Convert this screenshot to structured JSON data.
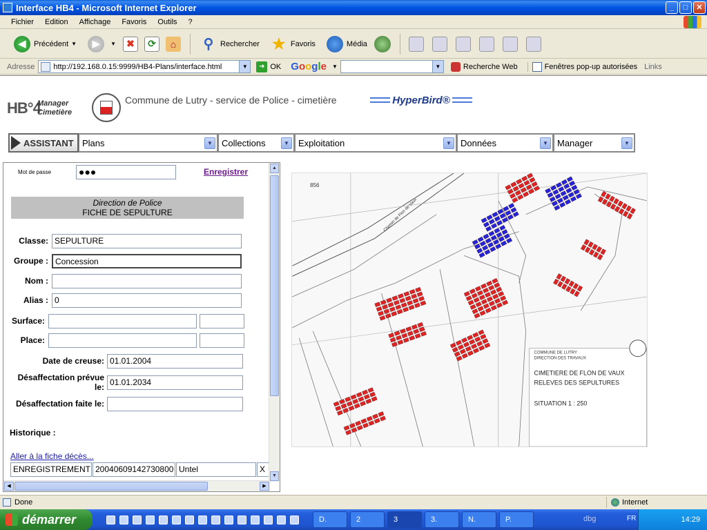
{
  "window": {
    "title": "Interface HB4 - Microsoft Internet Explorer",
    "buttons": [
      "_",
      "□",
      "✕"
    ]
  },
  "menubar": [
    "Fichier",
    "Edition",
    "Affichage",
    "Favoris",
    "Outils",
    "?"
  ],
  "toolbar": {
    "back_label": "Précédent",
    "search_label": "Rechercher",
    "favorites_label": "Favoris",
    "media_label": "Média"
  },
  "addressbar": {
    "label": "Adresse",
    "url": "http://192.168.0.15:9999/HB4-Plans/interface.html",
    "go_label": "OK",
    "google_search_value": "",
    "web_search_label": "Recherche Web",
    "popup_label": "Fenêtres pop-up autorisées",
    "links_label": "Links"
  },
  "app_header": {
    "logo_main": "HB°4",
    "logo_sub_line1": "Manager",
    "logo_sub_line2": "Cimetière",
    "commune_title": "Commune de Lutry - service de Police - cimetière",
    "brand": "HyperBird®"
  },
  "nav": {
    "assistant_label": "ASSISTANT",
    "menus": [
      {
        "label": "Plans"
      },
      {
        "label": "Collections"
      },
      {
        "label": "Exploitation"
      },
      {
        "label": "Données"
      },
      {
        "label": "Manager"
      }
    ]
  },
  "form": {
    "password_label": "Mot de passe",
    "password_value": "●●●",
    "save_link": "Enregistrer",
    "section_line1": "Direction de Police",
    "section_line2": "FICHE DE SEPULTURE",
    "classe_label": "Classe:",
    "classe_value": "SEPULTURE",
    "groupe_label": "Groupe :",
    "groupe_value": "Concession",
    "nom_label": "Nom :",
    "nom_value": "",
    "alias_label": "Alias :",
    "alias_value": "0",
    "surface_label": "Surface:",
    "place_label": "Place:",
    "date_creuse_label": "Date de creuse:",
    "date_creuse_value": "01.01.2004",
    "desaff_prevue_label_line1": "Désaffectation prévue",
    "desaff_prevue_label_line2": "le:",
    "desaff_prevue_value": "01.01.2034",
    "desaff_faite_label": "Désaffectation faite le:",
    "desaff_faite_value": "",
    "historique_label": "Historique :",
    "deces_link": "Aller à la fiche décès...",
    "history_row": [
      "ENREGISTREMENT",
      "20040609142730800",
      "Untel",
      "X"
    ]
  },
  "map": {
    "parcel_number": "856",
    "road_label": "Chemin de Flon de Vaux",
    "commune_line1": "COMMUNE DE LUTRY",
    "commune_line2": "DIRECTION DES TRAVAUX",
    "cemetery_line1": "CIMETIERE DE FLON DE VAUX",
    "cemetery_line2": "RELEVES DES SEPULTURES",
    "situation": "SITUATION  1 : 250",
    "colors": {
      "occupied": "#e02424",
      "concession": "#2424d8",
      "line": "#555555"
    }
  },
  "statusbar": {
    "status": "Done",
    "zone": "Internet"
  },
  "taskbar": {
    "start_label": "démarrer",
    "tasks": [
      "D.",
      "2",
      "3",
      "3.",
      "N.",
      "P."
    ],
    "tray_extra": "dbg",
    "lang": "FR",
    "clock": "14:29"
  }
}
